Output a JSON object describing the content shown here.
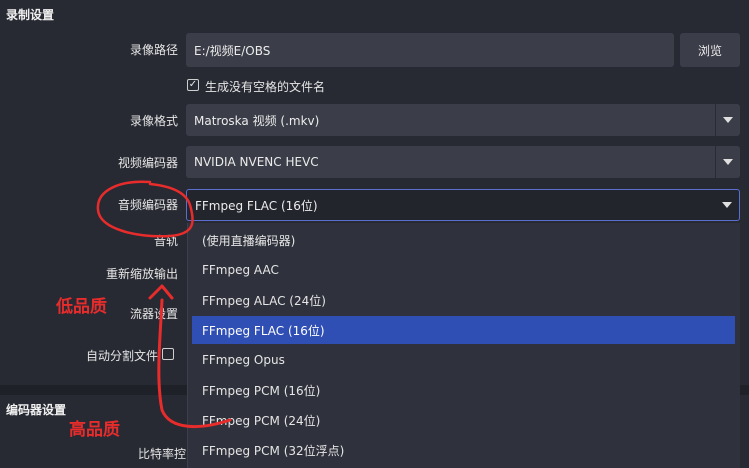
{
  "sections": {
    "recording": "录制设置",
    "encoder": "编码器设置"
  },
  "recording_path": {
    "label": "录像路径",
    "value": "E:/视频E/OBS",
    "browse_label": "浏览"
  },
  "no_space_checkbox": {
    "label": "生成没有空格的文件名",
    "checked": true,
    "mark": "✓"
  },
  "format": {
    "label": "录像格式",
    "value": "Matroska 视频 (.mkv)"
  },
  "video_encoder": {
    "label": "视频编码器",
    "value": "NVIDIA NVENC HEVC"
  },
  "audio_encoder": {
    "label": "音频编码器",
    "value": "FFmpeg FLAC (16位)",
    "options": [
      "(使用直播编码器)",
      "FFmpeg AAC",
      "FFmpeg ALAC (24位)",
      "FFmpeg FLAC (16位)",
      "FFmpeg Opus",
      "FFmpeg PCM (16位)",
      "FFmpeg PCM (24位)",
      "FFmpeg PCM (32位浮点)"
    ],
    "selected_index": 3
  },
  "audio_track": {
    "label": "音轨"
  },
  "rescale": {
    "label": "重新缩放输出"
  },
  "muxer_settings": {
    "label": "流器设置"
  },
  "auto_split": {
    "label": "自动分割文件"
  },
  "bitrate": {
    "label": "比特率控"
  },
  "annotations": {
    "low_quality": "低品质",
    "high_quality": "高品质",
    "color": "#e82c2c"
  },
  "colors": {
    "background": "#1f2129",
    "panel": "#272a33",
    "field": "#3b3e49",
    "selection": "#2f4fb4"
  }
}
